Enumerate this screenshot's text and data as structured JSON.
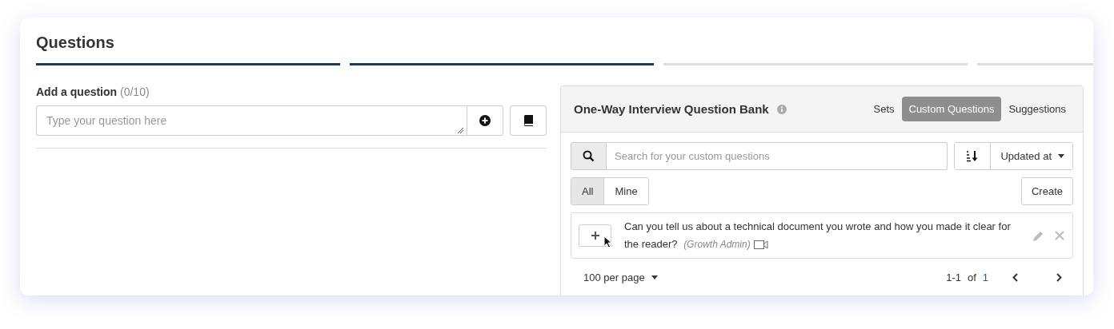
{
  "title": "Questions",
  "steps": [
    {
      "done": true
    },
    {
      "done": true
    },
    {
      "done": false
    },
    {
      "done": false
    }
  ],
  "add_question": {
    "label": "Add a question",
    "count": "(0/10)",
    "placeholder": "Type your question here"
  },
  "bank": {
    "title": "One-Way Interview Question Bank",
    "tabs": [
      {
        "label": "Sets",
        "selected": false
      },
      {
        "label": "Custom Questions",
        "selected": true
      },
      {
        "label": "Suggestions",
        "selected": false
      }
    ],
    "search": {
      "placeholder": "Search for your custom questions"
    },
    "sort": {
      "value": "Updated at"
    },
    "filters": [
      {
        "label": "All",
        "selected": true
      },
      {
        "label": "Mine",
        "selected": false
      }
    ],
    "create_button": "Create",
    "questions": [
      {
        "text": "Can you tell us about a technical document you wrote and how you made it clear for the reader?",
        "author": "(Growth Admin)",
        "video": true
      }
    ],
    "per_page": "100 per page",
    "range": "1-1",
    "of": "of",
    "total": "1"
  }
}
